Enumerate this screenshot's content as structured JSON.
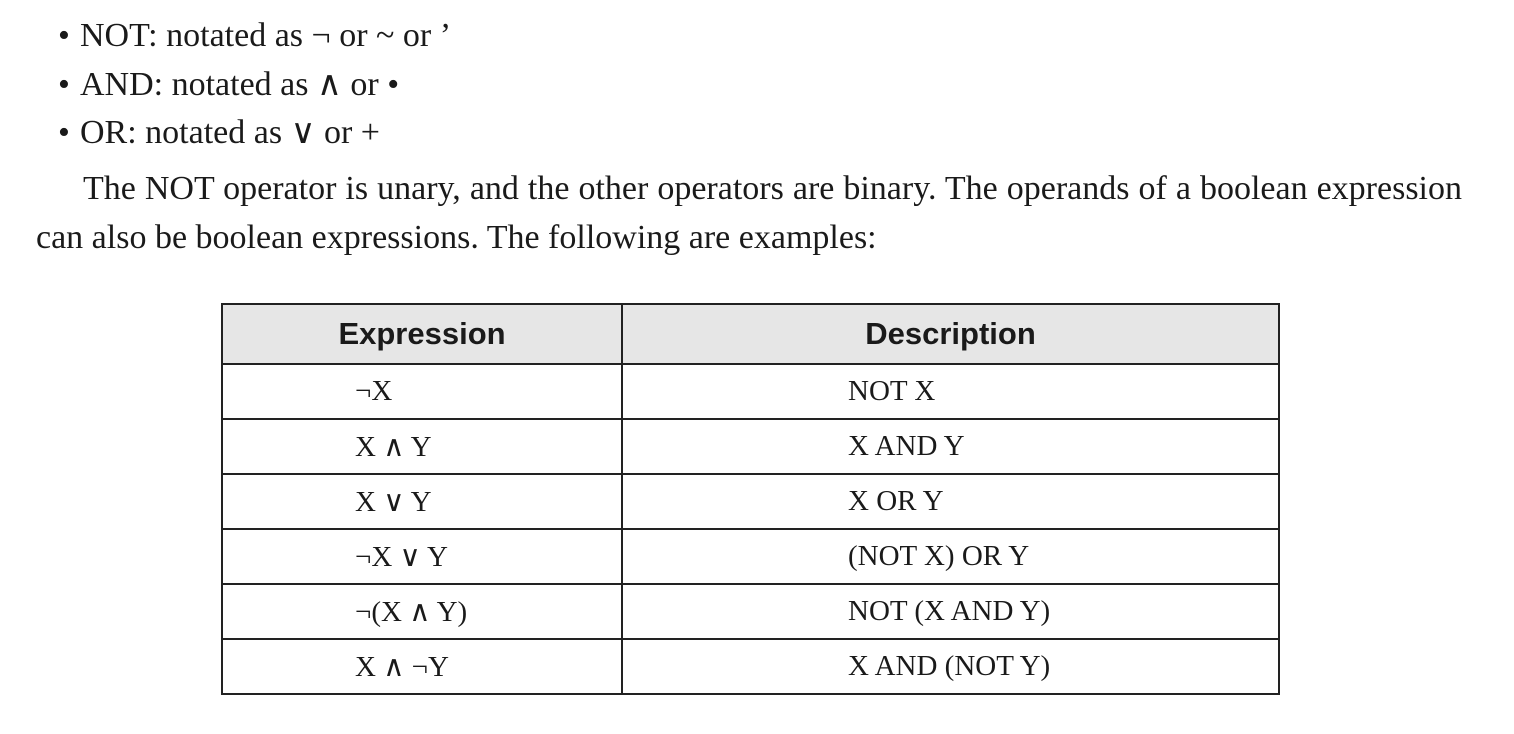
{
  "bullets": [
    {
      "marker": "•",
      "text": "NOT: notated as ¬ or ~ or ’"
    },
    {
      "marker": "•",
      "text": "AND: notated as ∧ or •"
    },
    {
      "marker": "•",
      "text": "OR: notated as ∨ or +"
    }
  ],
  "paragraph": "The NOT operator is unary, and the other operators are binary. The operands of a boolean expression can also be boolean expressions. The following are examples:",
  "table": {
    "headers": [
      "Expression",
      "Description"
    ],
    "rows": [
      {
        "expression": "¬X",
        "description": "NOT X"
      },
      {
        "expression": "X ∧ Y",
        "description": "X AND Y"
      },
      {
        "expression": "X ∨  Y",
        "description": "X OR Y"
      },
      {
        "expression": "¬X ∨  Y",
        "description": "(NOT X) OR Y"
      },
      {
        "expression": "¬(X ∧ Y)",
        "description": "NOT (X AND Y)"
      },
      {
        "expression": "X ∧ ¬Y",
        "description": "X AND (NOT Y)"
      }
    ]
  }
}
